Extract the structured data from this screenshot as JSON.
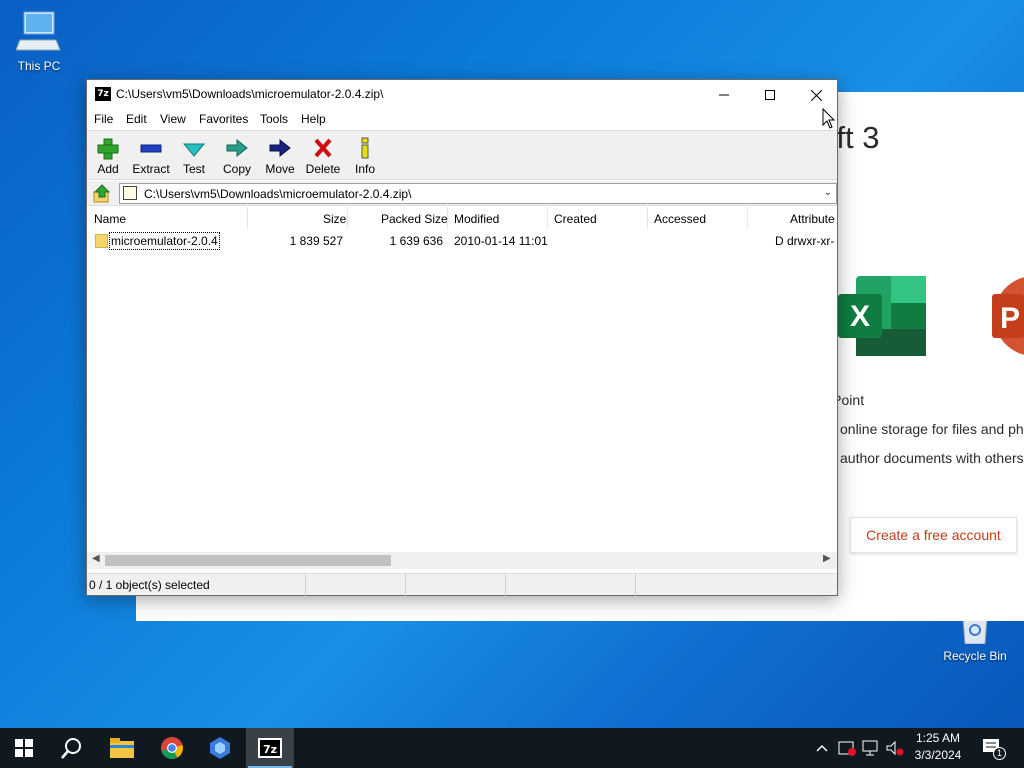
{
  "desktop": {
    "icons": [
      {
        "label": "This PC"
      },
      {
        "label": "Recycle Bin"
      }
    ]
  },
  "office_window": {
    "title": "e Microsoft 3",
    "lines": [
      "rd, Excel, and PowerPoint",
      "online storage for files and ph",
      "author documents with others"
    ],
    "button": "Create a free account",
    "accent_color": "#c43e1c"
  },
  "zip_window": {
    "title": "C:\\Users\\vm5\\Downloads\\microemulator-2.0.4.zip\\",
    "app_icon_text": "7z",
    "menu": [
      "File",
      "Edit",
      "View",
      "Favorites",
      "Tools",
      "Help"
    ],
    "toolbar": [
      {
        "label": "Add",
        "icon": "plus-icon"
      },
      {
        "label": "Extract",
        "icon": "minus-icon"
      },
      {
        "label": "Test",
        "icon": "checkmark-icon"
      },
      {
        "label": "Copy",
        "icon": "double-arrow-icon"
      },
      {
        "label": "Move",
        "icon": "arrow-right-icon"
      },
      {
        "label": "Delete",
        "icon": "x-icon"
      },
      {
        "label": "Info",
        "icon": "info-icon"
      }
    ],
    "address": "C:\\Users\\vm5\\Downloads\\microemulator-2.0.4.zip\\",
    "columns": [
      "Name",
      "Size",
      "Packed Size",
      "Modified",
      "Created",
      "Accessed",
      "Attribute"
    ],
    "rows": [
      {
        "name": "microemulator-2.0.4",
        "size": "1 839 527",
        "packed_size": "1 639 636",
        "modified": "2010-01-14 11:01",
        "created": "",
        "accessed": "",
        "attributes": "D drwxr-xr-"
      }
    ],
    "status": "0 / 1 object(s) selected"
  },
  "taskbar": {
    "items": [
      "start-icon",
      "search-icon",
      "file-explorer-icon",
      "chrome-icon",
      "app-icon",
      "7zip-icon"
    ],
    "clock_time": "1:25 AM",
    "clock_date": "3/3/2024",
    "notification_count": "1"
  }
}
